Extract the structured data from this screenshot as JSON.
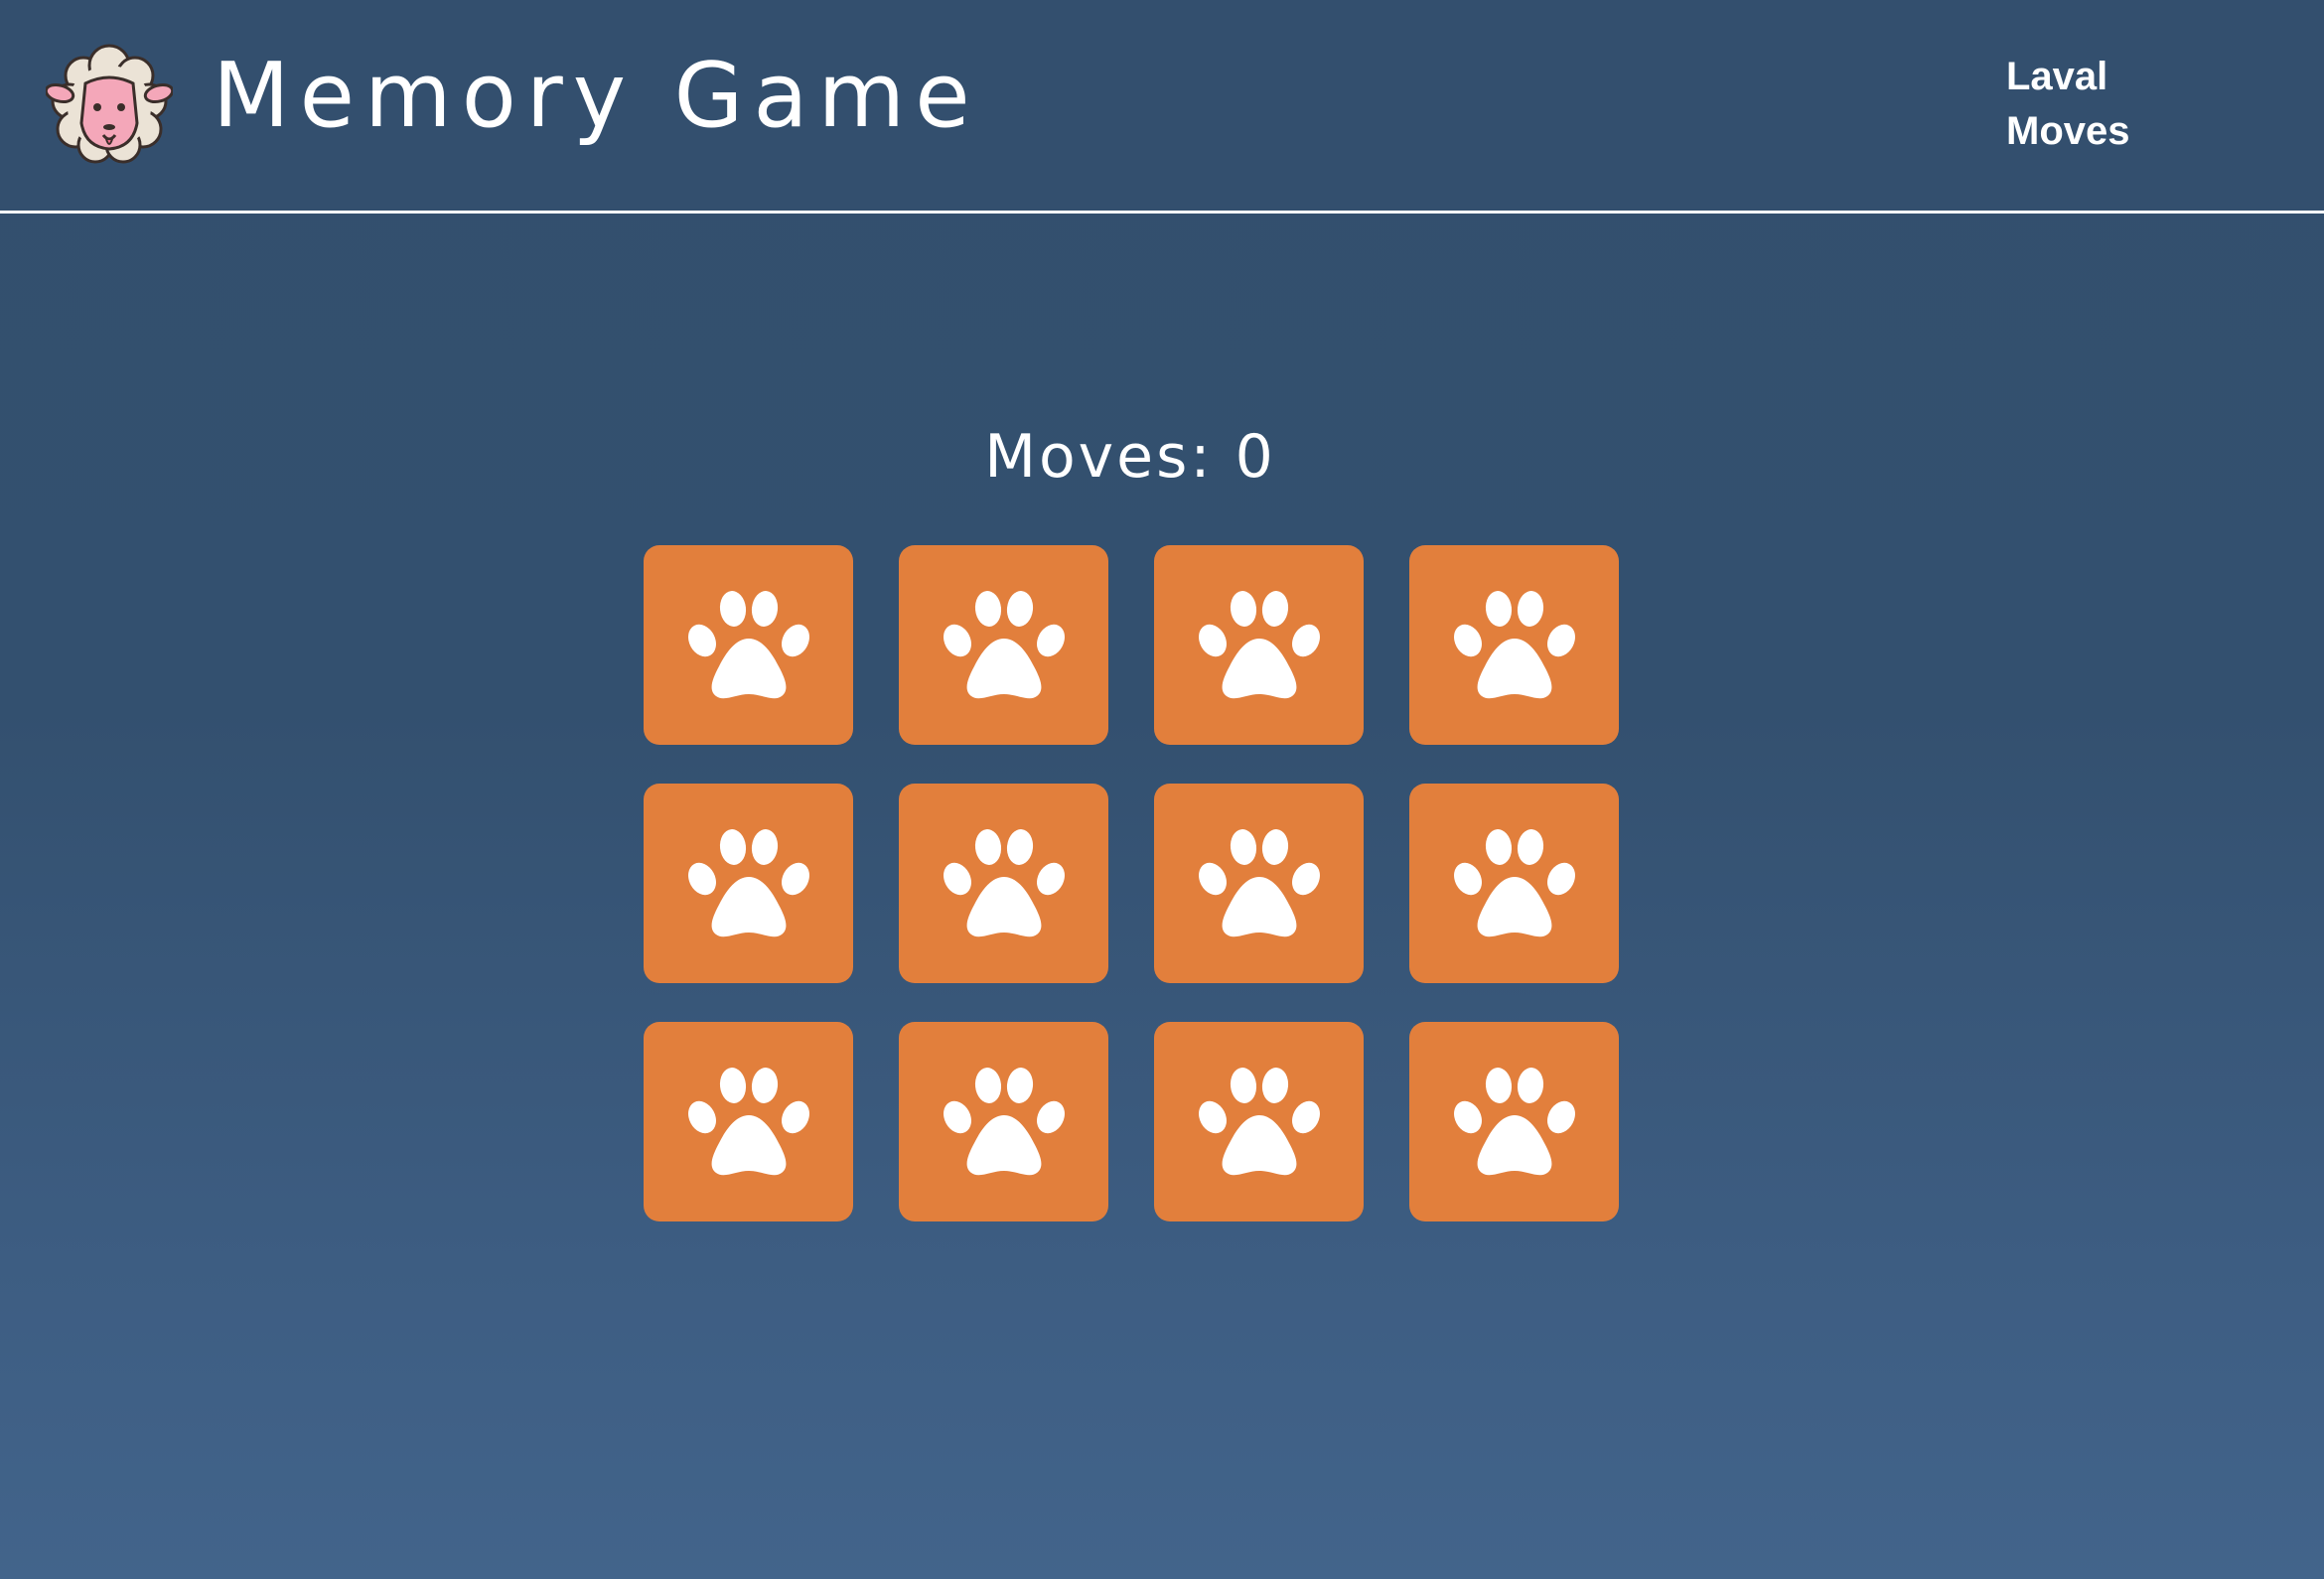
{
  "header": {
    "title": "Memory Game",
    "logo": "sheep-icon",
    "nav": [
      {
        "label": "Laval"
      },
      {
        "label": "Moves"
      }
    ]
  },
  "game": {
    "moves_text": "Moves: 0",
    "moves": 0,
    "card_back_icon": "paw-icon",
    "card_count": 12,
    "card_color": "#e27f3c"
  },
  "colors": {
    "background": "#334f6e",
    "card": "#e27f3c",
    "text": "#ffffff",
    "header_rule": "#ffffff"
  }
}
